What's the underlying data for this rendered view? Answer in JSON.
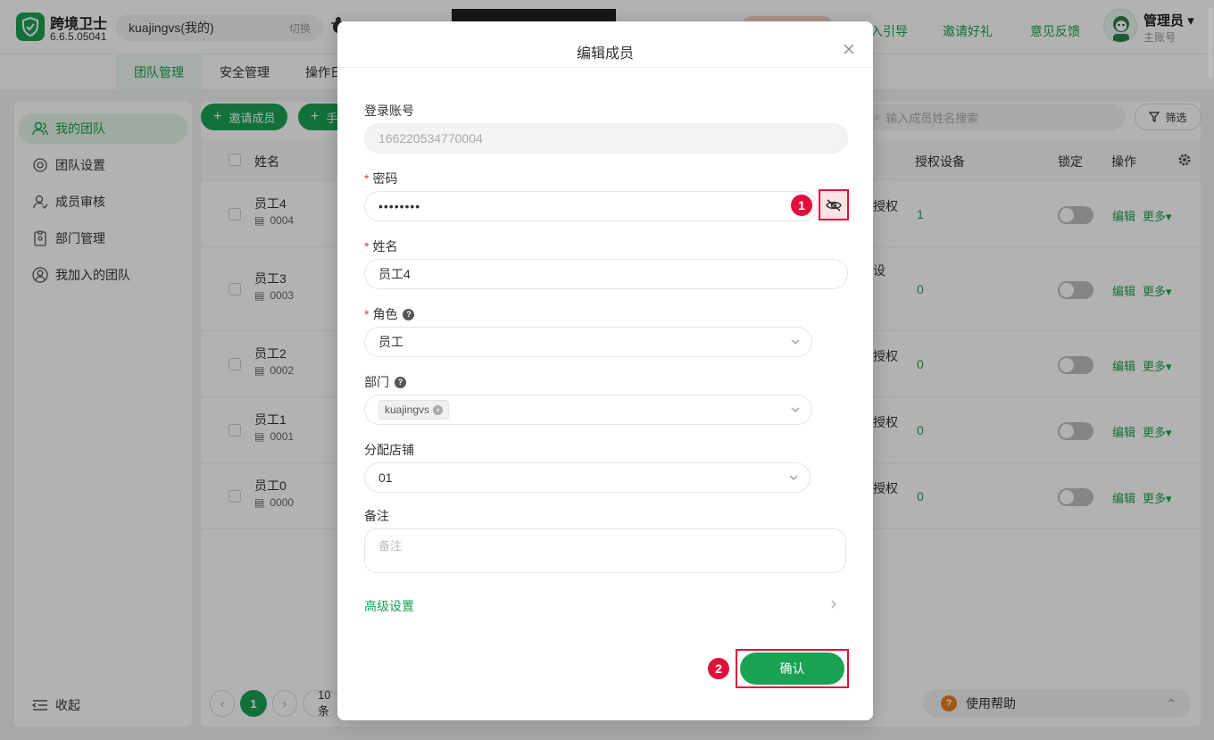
{
  "app": {
    "name": "跨境卫士",
    "version": "6.6.5.05041",
    "account": "kuajingvs(我的)",
    "switch_label": "切换"
  },
  "header_links": [
    "入引导",
    "邀请好礼",
    "意见反馈"
  ],
  "user": {
    "name": "管理员",
    "sub": "主账号"
  },
  "tabs": [
    {
      "label": "团队管理"
    },
    {
      "label": "安全管理"
    },
    {
      "label": "操作日"
    }
  ],
  "sidebar": {
    "items": [
      {
        "label": "我的团队"
      },
      {
        "label": "团队设置"
      },
      {
        "label": "成员审核"
      },
      {
        "label": "部门管理"
      },
      {
        "label": "我加入的团队"
      }
    ],
    "collapse_label": "收起"
  },
  "toolbar": {
    "invite_label": "邀请成员",
    "second_label": "手",
    "search_placeholder": "输入成员姓名搜索",
    "filter_label": "筛选"
  },
  "table": {
    "headers": {
      "name": "姓名",
      "devices": "授权设备",
      "lock": "锁定",
      "ops": "操作"
    },
    "rows": [
      {
        "name": "员工4",
        "id": "0004",
        "auth": "授权",
        "devices": "1"
      },
      {
        "name": "员工3",
        "id": "0003",
        "auth": "设",
        "devices": "0"
      },
      {
        "name": "员工2",
        "id": "0002",
        "auth": "授权",
        "devices": "0"
      },
      {
        "name": "员工1",
        "id": "0001",
        "auth": "授权",
        "devices": "0"
      },
      {
        "name": "员工0",
        "id": "0000",
        "auth": "授权",
        "devices": "0"
      }
    ],
    "edit_label": "编辑",
    "more_label": "更多"
  },
  "pagination": {
    "current": "1",
    "page_size": "10条"
  },
  "help_label": "使用帮助",
  "modal": {
    "title": "编辑成员",
    "login_label": "登录账号",
    "login_value": "166220534770004",
    "password_label": "密码",
    "password_value": "••••••••",
    "name_label": "姓名",
    "name_value": "员工4",
    "role_label": "角色",
    "role_value": "员工",
    "dept_label": "部门",
    "dept_tag": "kuajingvs",
    "store_label": "分配店铺",
    "store_value": "01",
    "note_label": "备注",
    "note_placeholder": "备注",
    "advanced_label": "高级设置",
    "confirm_label": "确认"
  },
  "markers": {
    "m1": "1",
    "m2": "2"
  },
  "colors": {
    "brand": "#1aa253",
    "highlight": "#e0103a"
  }
}
